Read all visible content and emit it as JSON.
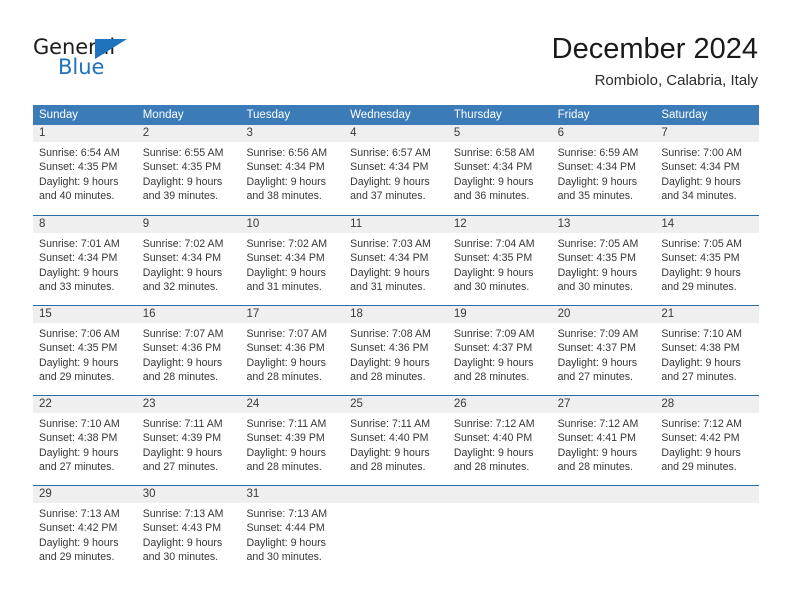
{
  "logo": {
    "text_top": "General",
    "text_bottom": "Blue",
    "accent_color": "#1f72bd"
  },
  "header": {
    "title": "December 2024",
    "subtitle": "Rombiolo, Calabria, Italy"
  },
  "theme": {
    "header_bar_color": "#3b7cb8",
    "row_divider_color": "#2b6ca8",
    "day_number_bar_color": "#efefef"
  },
  "weekdays": [
    "Sunday",
    "Monday",
    "Tuesday",
    "Wednesday",
    "Thursday",
    "Friday",
    "Saturday"
  ],
  "weeks": [
    [
      {
        "day": "1",
        "lines": [
          "Sunrise: 6:54 AM",
          "Sunset: 4:35 PM",
          "Daylight: 9 hours",
          "and 40 minutes."
        ]
      },
      {
        "day": "2",
        "lines": [
          "Sunrise: 6:55 AM",
          "Sunset: 4:35 PM",
          "Daylight: 9 hours",
          "and 39 minutes."
        ]
      },
      {
        "day": "3",
        "lines": [
          "Sunrise: 6:56 AM",
          "Sunset: 4:34 PM",
          "Daylight: 9 hours",
          "and 38 minutes."
        ]
      },
      {
        "day": "4",
        "lines": [
          "Sunrise: 6:57 AM",
          "Sunset: 4:34 PM",
          "Daylight: 9 hours",
          "and 37 minutes."
        ]
      },
      {
        "day": "5",
        "lines": [
          "Sunrise: 6:58 AM",
          "Sunset: 4:34 PM",
          "Daylight: 9 hours",
          "and 36 minutes."
        ]
      },
      {
        "day": "6",
        "lines": [
          "Sunrise: 6:59 AM",
          "Sunset: 4:34 PM",
          "Daylight: 9 hours",
          "and 35 minutes."
        ]
      },
      {
        "day": "7",
        "lines": [
          "Sunrise: 7:00 AM",
          "Sunset: 4:34 PM",
          "Daylight: 9 hours",
          "and 34 minutes."
        ]
      }
    ],
    [
      {
        "day": "8",
        "lines": [
          "Sunrise: 7:01 AM",
          "Sunset: 4:34 PM",
          "Daylight: 9 hours",
          "and 33 minutes."
        ]
      },
      {
        "day": "9",
        "lines": [
          "Sunrise: 7:02 AM",
          "Sunset: 4:34 PM",
          "Daylight: 9 hours",
          "and 32 minutes."
        ]
      },
      {
        "day": "10",
        "lines": [
          "Sunrise: 7:02 AM",
          "Sunset: 4:34 PM",
          "Daylight: 9 hours",
          "and 31 minutes."
        ]
      },
      {
        "day": "11",
        "lines": [
          "Sunrise: 7:03 AM",
          "Sunset: 4:34 PM",
          "Daylight: 9 hours",
          "and 31 minutes."
        ]
      },
      {
        "day": "12",
        "lines": [
          "Sunrise: 7:04 AM",
          "Sunset: 4:35 PM",
          "Daylight: 9 hours",
          "and 30 minutes."
        ]
      },
      {
        "day": "13",
        "lines": [
          "Sunrise: 7:05 AM",
          "Sunset: 4:35 PM",
          "Daylight: 9 hours",
          "and 30 minutes."
        ]
      },
      {
        "day": "14",
        "lines": [
          "Sunrise: 7:05 AM",
          "Sunset: 4:35 PM",
          "Daylight: 9 hours",
          "and 29 minutes."
        ]
      }
    ],
    [
      {
        "day": "15",
        "lines": [
          "Sunrise: 7:06 AM",
          "Sunset: 4:35 PM",
          "Daylight: 9 hours",
          "and 29 minutes."
        ]
      },
      {
        "day": "16",
        "lines": [
          "Sunrise: 7:07 AM",
          "Sunset: 4:36 PM",
          "Daylight: 9 hours",
          "and 28 minutes."
        ]
      },
      {
        "day": "17",
        "lines": [
          "Sunrise: 7:07 AM",
          "Sunset: 4:36 PM",
          "Daylight: 9 hours",
          "and 28 minutes."
        ]
      },
      {
        "day": "18",
        "lines": [
          "Sunrise: 7:08 AM",
          "Sunset: 4:36 PM",
          "Daylight: 9 hours",
          "and 28 minutes."
        ]
      },
      {
        "day": "19",
        "lines": [
          "Sunrise: 7:09 AM",
          "Sunset: 4:37 PM",
          "Daylight: 9 hours",
          "and 28 minutes."
        ]
      },
      {
        "day": "20",
        "lines": [
          "Sunrise: 7:09 AM",
          "Sunset: 4:37 PM",
          "Daylight: 9 hours",
          "and 27 minutes."
        ]
      },
      {
        "day": "21",
        "lines": [
          "Sunrise: 7:10 AM",
          "Sunset: 4:38 PM",
          "Daylight: 9 hours",
          "and 27 minutes."
        ]
      }
    ],
    [
      {
        "day": "22",
        "lines": [
          "Sunrise: 7:10 AM",
          "Sunset: 4:38 PM",
          "Daylight: 9 hours",
          "and 27 minutes."
        ]
      },
      {
        "day": "23",
        "lines": [
          "Sunrise: 7:11 AM",
          "Sunset: 4:39 PM",
          "Daylight: 9 hours",
          "and 27 minutes."
        ]
      },
      {
        "day": "24",
        "lines": [
          "Sunrise: 7:11 AM",
          "Sunset: 4:39 PM",
          "Daylight: 9 hours",
          "and 28 minutes."
        ]
      },
      {
        "day": "25",
        "lines": [
          "Sunrise: 7:11 AM",
          "Sunset: 4:40 PM",
          "Daylight: 9 hours",
          "and 28 minutes."
        ]
      },
      {
        "day": "26",
        "lines": [
          "Sunrise: 7:12 AM",
          "Sunset: 4:40 PM",
          "Daylight: 9 hours",
          "and 28 minutes."
        ]
      },
      {
        "day": "27",
        "lines": [
          "Sunrise: 7:12 AM",
          "Sunset: 4:41 PM",
          "Daylight: 9 hours",
          "and 28 minutes."
        ]
      },
      {
        "day": "28",
        "lines": [
          "Sunrise: 7:12 AM",
          "Sunset: 4:42 PM",
          "Daylight: 9 hours",
          "and 29 minutes."
        ]
      }
    ],
    [
      {
        "day": "29",
        "lines": [
          "Sunrise: 7:13 AM",
          "Sunset: 4:42 PM",
          "Daylight: 9 hours",
          "and 29 minutes."
        ]
      },
      {
        "day": "30",
        "lines": [
          "Sunrise: 7:13 AM",
          "Sunset: 4:43 PM",
          "Daylight: 9 hours",
          "and 30 minutes."
        ]
      },
      {
        "day": "31",
        "lines": [
          "Sunrise: 7:13 AM",
          "Sunset: 4:44 PM",
          "Daylight: 9 hours",
          "and 30 minutes."
        ]
      },
      {
        "day": "",
        "lines": []
      },
      {
        "day": "",
        "lines": []
      },
      {
        "day": "",
        "lines": []
      },
      {
        "day": "",
        "lines": []
      }
    ]
  ]
}
